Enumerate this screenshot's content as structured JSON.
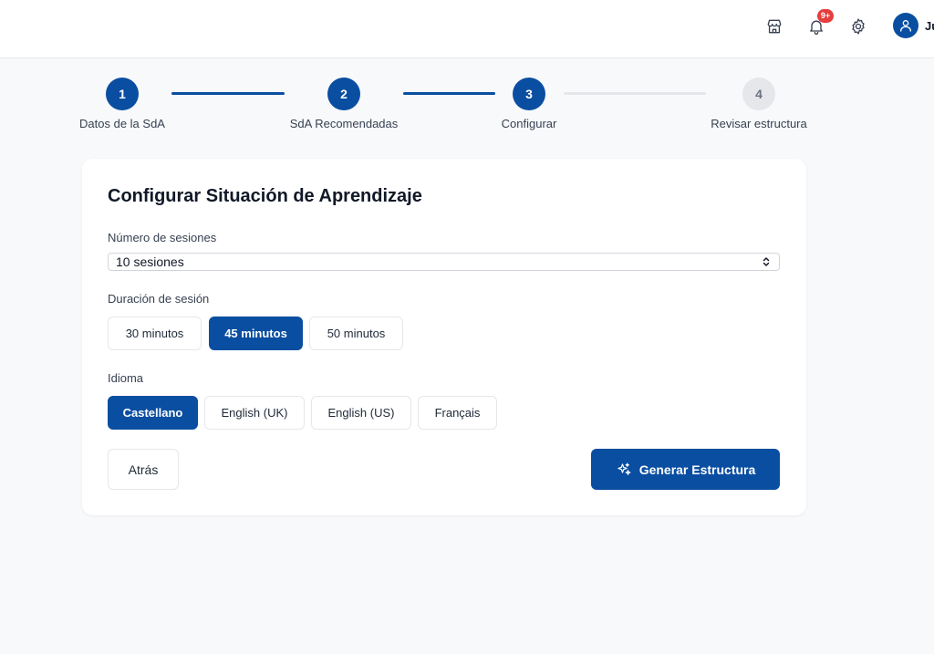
{
  "header": {
    "notification_count": "9+",
    "user_name": "Ju",
    "icons": [
      "store-icon",
      "bell-icon",
      "gear-icon",
      "user-icon"
    ]
  },
  "stepper": {
    "steps": [
      {
        "number": "1",
        "label": "Datos de la SdA",
        "state": "done"
      },
      {
        "number": "2",
        "label": "SdA Recomendadas",
        "state": "done"
      },
      {
        "number": "3",
        "label": "Configurar",
        "state": "current"
      },
      {
        "number": "4",
        "label": "Revisar estructura",
        "state": "todo"
      }
    ]
  },
  "form": {
    "title": "Configurar Situación de Aprendizaje",
    "sessions": {
      "label": "Número de sesiones",
      "value": "10 sesiones"
    },
    "duration": {
      "label": "Duración de sesión",
      "options": [
        "30 minutos",
        "45 minutos",
        "50 minutos"
      ],
      "selected": "45 minutos"
    },
    "language": {
      "label": "Idioma",
      "options": [
        "Castellano",
        "English (UK)",
        "English (US)",
        "Français"
      ],
      "selected": "Castellano"
    },
    "back_label": "Atrás",
    "generate_label": "Generar Estructura"
  },
  "colors": {
    "primary": "#0a4ea1",
    "badge": "#e53e3e",
    "inactive": "#e5e7eb"
  }
}
